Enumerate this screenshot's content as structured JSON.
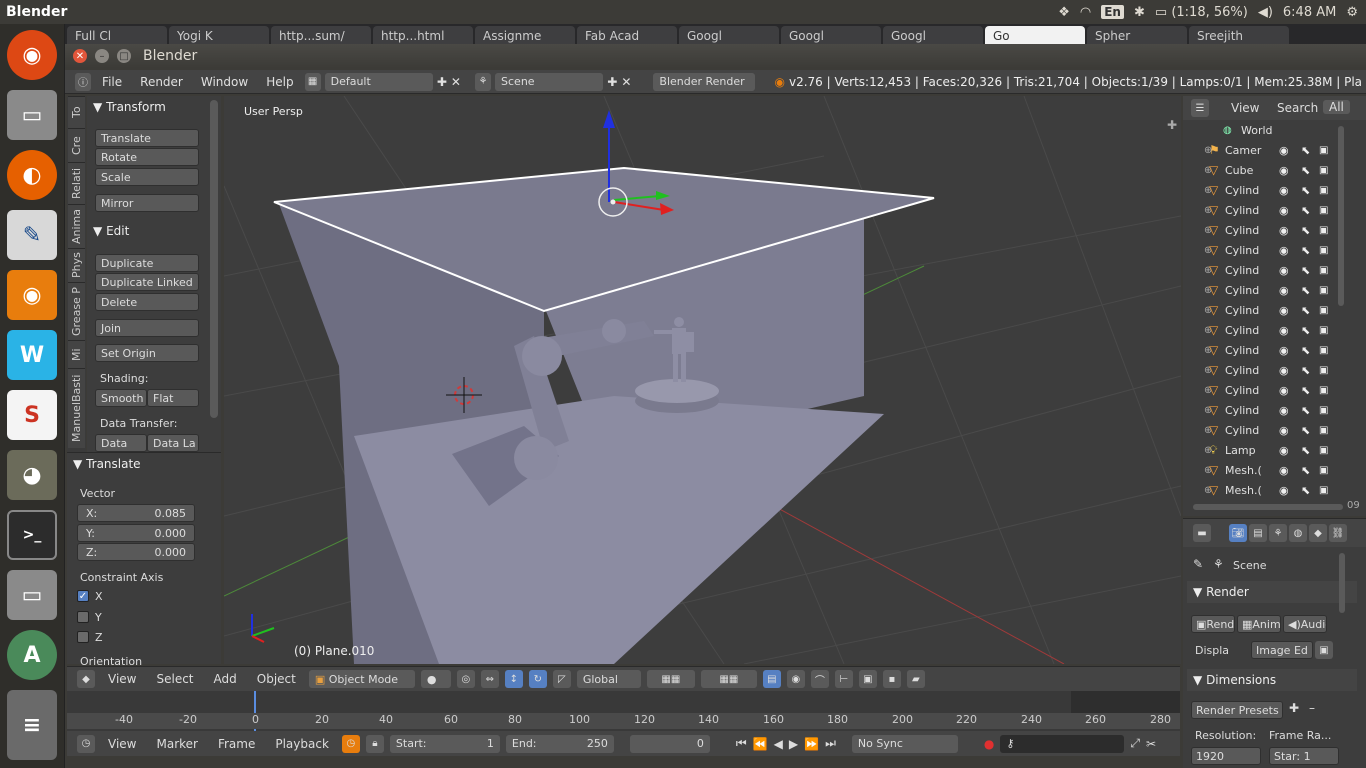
{
  "system": {
    "app_name": "Blender",
    "keyboard_layout": "En",
    "battery": "(1:18, 56%)",
    "clock": "6:48 AM"
  },
  "browser_tabs": [
    "Full Cl",
    "Yogi K",
    "http...sum/",
    "http...html",
    "Assignme",
    "Fab Acad",
    "Googl",
    "Googl",
    "Googl",
    "Go",
    "Spher",
    "Sreejith"
  ],
  "window": {
    "title": "Blender"
  },
  "info_header": {
    "menus": [
      "File",
      "Render",
      "Window",
      "Help"
    ],
    "layout": "Default",
    "scene": "Scene",
    "engine": "Blender Render",
    "stats": "v2.76 | Verts:12,453 | Faces:20,326 | Tris:21,704 | Objects:1/39 | Lamps:0/1 | Mem:25.38M | Pla"
  },
  "tool_tabs": [
    "To",
    "Cre",
    "Relati",
    "Anima",
    "Phys",
    "Grease P",
    "Mi",
    "ManuelBasti"
  ],
  "tool_shelf": {
    "transform_header": "Transform",
    "translate": "Translate",
    "rotate": "Rotate",
    "scale": "Scale",
    "mirror": "Mirror",
    "edit_header": "Edit",
    "duplicate": "Duplicate",
    "duplicate_linked": "Duplicate Linked",
    "delete": "Delete",
    "join": "Join",
    "set_origin": "Set Origin",
    "shading_label": "Shading:",
    "smooth": "Smooth",
    "flat": "Flat",
    "data_transfer_label": "Data Transfer:",
    "data": "Data",
    "data_layout": "Data La"
  },
  "operator_panel": {
    "header": "Translate",
    "vector_label": "Vector",
    "x_label": "X:",
    "x_value": "0.085",
    "y_label": "Y:",
    "y_value": "0.000",
    "z_label": "Z:",
    "z_value": "0.000",
    "constraint_label": "Constraint Axis",
    "cx": "X",
    "cy": "Y",
    "cz": "Z",
    "orientation_label": "Orientation"
  },
  "viewport": {
    "view_name": "User Persp",
    "object_info": "(0) Plane.010"
  },
  "viewport_header": {
    "view": "View",
    "select": "Select",
    "add": "Add",
    "object": "Object",
    "mode": "Object Mode",
    "orientation": "Global"
  },
  "timeline": {
    "ticks": [
      "-40",
      "-20",
      "0",
      "20",
      "40",
      "60",
      "80",
      "100",
      "120",
      "140",
      "160",
      "180",
      "200",
      "220",
      "240",
      "260",
      "280"
    ],
    "view": "View",
    "marker": "Marker",
    "frame": "Frame",
    "playback": "Playback",
    "start_label": "Start:",
    "start": "1",
    "end_label": "End:",
    "end": "250",
    "current": "0",
    "sync": "No Sync"
  },
  "outliner": {
    "view": "View",
    "search": "Search",
    "all": "All",
    "items": [
      "World",
      "Camer",
      "Cube",
      "Cylind",
      "Cylind",
      "Cylind",
      "Cylind",
      "Cylind",
      "Cylind",
      "Cylind",
      "Cylind",
      "Cylind",
      "Cylind",
      "Cylind",
      "Cylind",
      "Cylind",
      "Lamp",
      "Mesh.(",
      "Mesh.("
    ],
    "scroll_num": "09"
  },
  "properties": {
    "scene": "Scene",
    "render_header": "Render",
    "rend": "Rend",
    "anim": "Anim",
    "audio": "Audio",
    "display_label": "Displa",
    "display_value": "Image Ed",
    "dimensions_header": "Dimensions",
    "presets": "Render Presets",
    "resolution_label": "Resolution:",
    "frame_rate": "Frame Ra...",
    "res_x": "1920",
    "start_short": "Star: 1"
  }
}
